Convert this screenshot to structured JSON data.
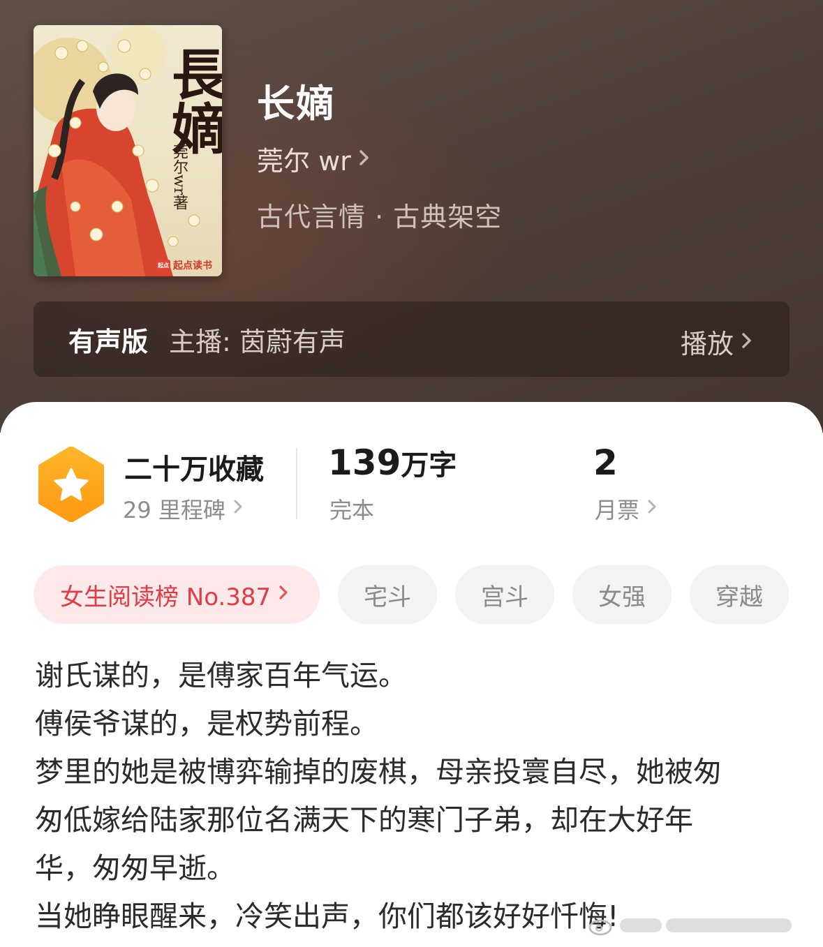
{
  "book": {
    "title": "长嫡",
    "author": "莞尔 wr",
    "genre": "古代言情 · 古典架空",
    "cover": {
      "title_text": "長嫡",
      "author_text": "莞尔wr著",
      "brand": "起点读书",
      "brand_logo": "起点"
    }
  },
  "audio": {
    "label": "有声版",
    "host": "主播: 茵蔚有声",
    "play": "播放"
  },
  "stats": {
    "favorites": "二十万收藏",
    "milestones": "29 里程碑",
    "word_count": "139",
    "word_unit": "万字",
    "status": "完本",
    "monthly_votes": "2",
    "monthly_votes_label": "月票"
  },
  "tags": {
    "rank": "女生阅读榜 No.387",
    "items": [
      "宅斗",
      "宫斗",
      "女强",
      "穿越"
    ]
  },
  "description": [
    "谢氏谋的，是傅家百年气运。",
    "傅侯爷谋的，是权势前程。",
    "梦里的她是被博弈输掉的废棋，母亲投寰自尽，她被匆",
    "匆低嫁给陆家那位名满天下的寒门子弟，却在大好年",
    "华，匆匆早逝。",
    "当她睁眼醒来，冷笑出声，你们都该好好忏悔!"
  ],
  "colors": {
    "accent_red": "#e23b45",
    "badge_orange": "#ffa51f",
    "header_bg": "#4f403b"
  }
}
